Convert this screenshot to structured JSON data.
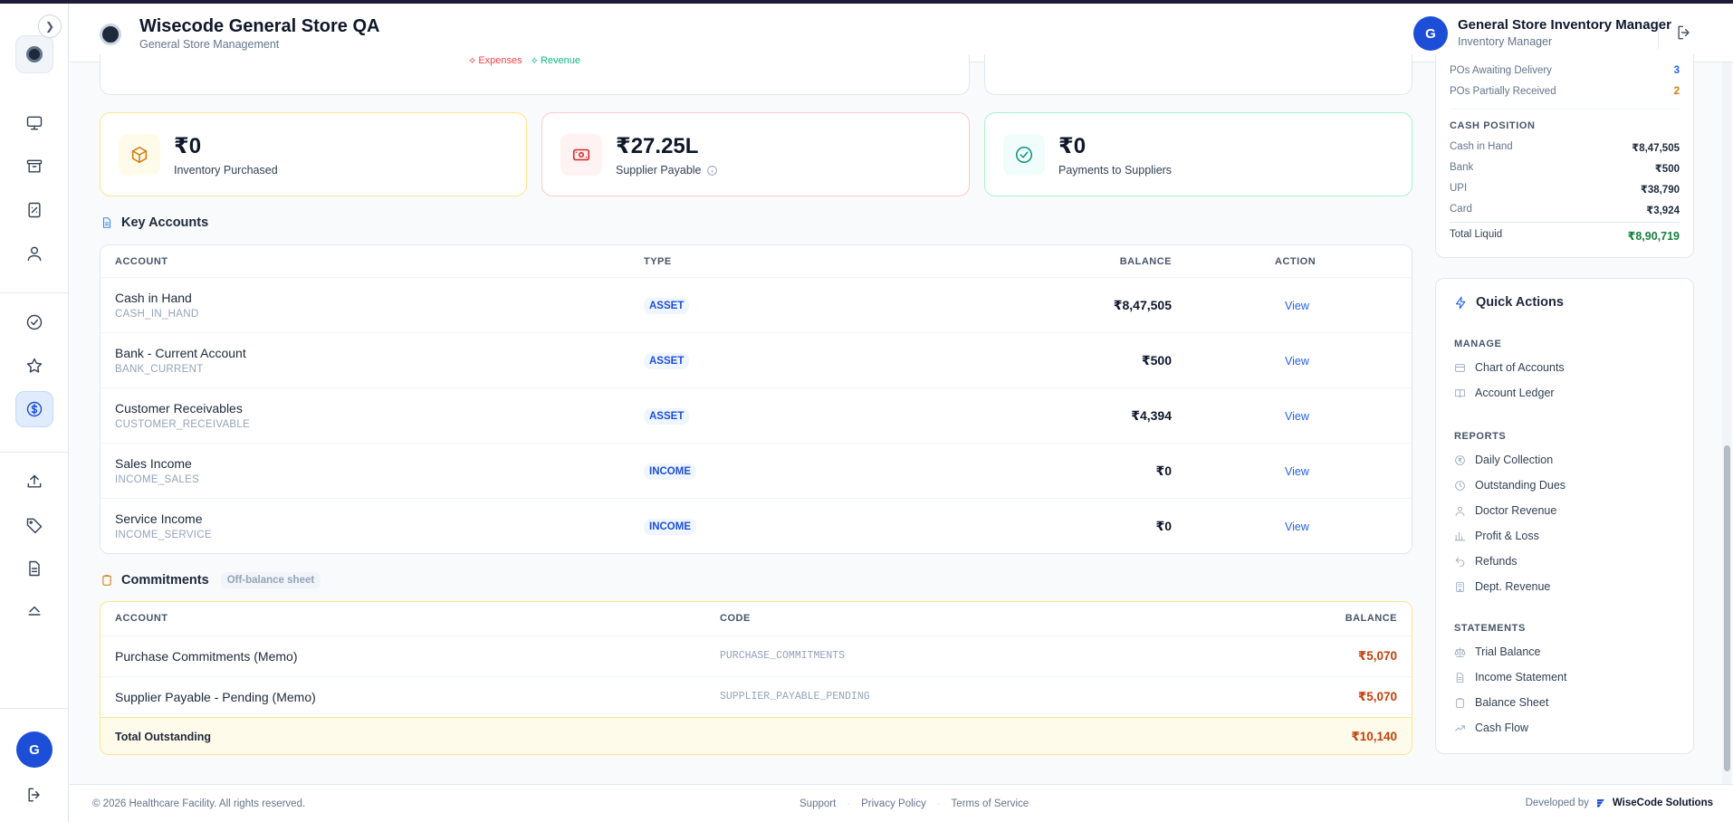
{
  "app": {
    "title": "Wisecode General Store QA",
    "subtitle": "General Store Management"
  },
  "user": {
    "initial": "G",
    "name": "General Store Inventory Manager",
    "role": "Inventory Manager"
  },
  "chart_legend": {
    "expenses": "Expenses",
    "revenue": "Revenue"
  },
  "stats": [
    {
      "value": "₹0",
      "label": "Inventory Purchased",
      "icon": "box-icon",
      "accent": "#f59e0b"
    },
    {
      "value": "₹27.25L",
      "label": "Supplier Payable",
      "icon": "cash-icon",
      "accent": "#ef4444",
      "info": "info-icon"
    },
    {
      "value": "₹0",
      "label": "Payments to Suppliers",
      "icon": "check-circle-icon",
      "accent": "#0d9488"
    }
  ],
  "key_accounts": {
    "title": "Key Accounts",
    "headers": {
      "account": "ACCOUNT",
      "type": "TYPE",
      "balance": "BALANCE",
      "action": "ACTION"
    },
    "rows": [
      {
        "name": "Cash in Hand",
        "code": "CASH_IN_HAND",
        "type": "ASSET",
        "balance": "₹8,47,505",
        "action": "View"
      },
      {
        "name": "Bank - Current Account",
        "code": "BANK_CURRENT",
        "type": "ASSET",
        "balance": "₹500",
        "action": "View"
      },
      {
        "name": "Customer Receivables",
        "code": "CUSTOMER_RECEIVABLE",
        "type": "ASSET",
        "balance": "₹4,394",
        "action": "View"
      },
      {
        "name": "Sales Income",
        "code": "INCOME_SALES",
        "type": "INCOME",
        "balance": "₹0",
        "action": "View"
      },
      {
        "name": "Service Income",
        "code": "INCOME_SERVICE",
        "type": "INCOME",
        "balance": "₹0",
        "action": "View"
      }
    ]
  },
  "commitments": {
    "title": "Commitments",
    "tag": "Off-balance sheet",
    "headers": {
      "account": "ACCOUNT",
      "code": "CODE",
      "balance": "BALANCE"
    },
    "rows": [
      {
        "name": "Purchase Commitments (Memo)",
        "code": "PURCHASE_COMMITMENTS",
        "balance": "₹5,070"
      },
      {
        "name": "Supplier Payable - Pending (Memo)",
        "code": "SUPPLIER_PAYABLE_PENDING",
        "balance": "₹5,070"
      }
    ],
    "total_label": "Total Outstanding",
    "total_value": "₹10,140"
  },
  "po_status": [
    {
      "label": "POs Awaiting Delivery",
      "value": "3",
      "color": "#2563eb"
    },
    {
      "label": "POs Partially Received",
      "value": "2",
      "color": "#d97706"
    }
  ],
  "cash_position": {
    "title": "CASH POSITION",
    "rows": [
      {
        "label": "Cash in Hand",
        "value": "₹8,47,505"
      },
      {
        "label": "Bank",
        "value": "₹500"
      },
      {
        "label": "UPI",
        "value": "₹38,790"
      },
      {
        "label": "Card",
        "value": "₹3,924"
      }
    ],
    "total_label": "Total Liquid",
    "total_value": "₹8,90,719"
  },
  "quick_actions": {
    "title": "Quick Actions",
    "manage_title": "MANAGE",
    "manage": [
      "Chart of Accounts",
      "Account Ledger"
    ],
    "reports_title": "REPORTS",
    "reports": [
      "Daily Collection",
      "Outstanding Dues",
      "Doctor Revenue",
      "Profit & Loss",
      "Refunds",
      "Dept. Revenue"
    ],
    "statements_title": "STATEMENTS",
    "statements": [
      "Trial Balance",
      "Income Statement",
      "Balance Sheet",
      "Cash Flow"
    ]
  },
  "footer": {
    "copyright": "© 2026 Healthcare Facility. All rights reserved.",
    "links": [
      "Support",
      "Privacy Policy",
      "Terms of Service"
    ],
    "developed_by": "Developed by",
    "brand": "WiseCode Solutions"
  }
}
